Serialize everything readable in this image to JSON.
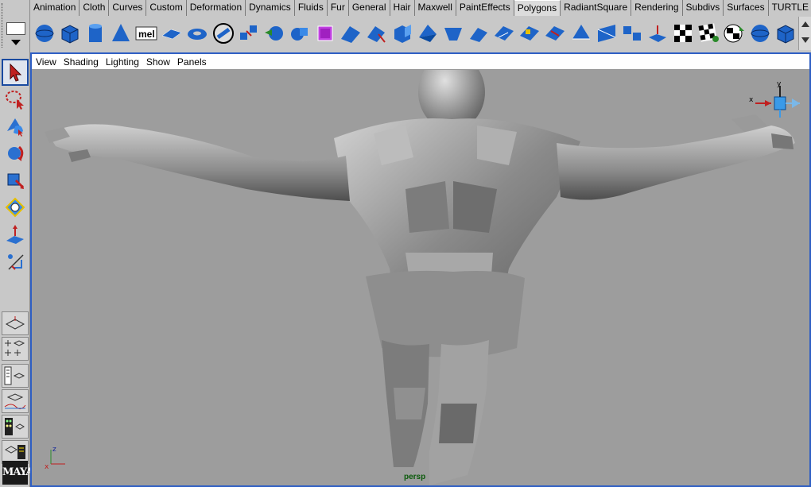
{
  "shelf": {
    "tabs": [
      "Animation",
      "Cloth",
      "Curves",
      "Custom",
      "Deformation",
      "Dynamics",
      "Fluids",
      "Fur",
      "General",
      "Hair",
      "Maxwell",
      "PaintEffects",
      "Polygons",
      "RadiantSquare",
      "Rendering",
      "Subdivs",
      "Surfaces",
      "TURTLE"
    ],
    "active_tab": "Polygons",
    "mel_label": "mel",
    "icons": [
      "poly-sphere-icon",
      "poly-cube-icon",
      "poly-cylinder-icon",
      "poly-cone-icon",
      "mel-script-icon",
      "poly-plane-icon",
      "poly-torus-icon",
      "poly-pipe-icon",
      "combine-icon",
      "boolean-icon",
      "separate-icon",
      "smooth-proxy-icon",
      "append-polygon-icon",
      "split-polygon-icon",
      "extrude-face-icon",
      "bevel-icon",
      "wedge-face-icon",
      "poke-face-icon",
      "duplicate-face-icon",
      "extract-icon",
      "merge-vertices-icon",
      "fill-hole-icon",
      "triangulate-icon",
      "quadrangulate-icon",
      "reduce-icon",
      "cleanup-icon",
      "uv-planar-icon",
      "uv-texture-editor-icon",
      "checker-map-icon",
      "uv-auto-icon"
    ]
  },
  "toolbox": {
    "tools": [
      "select-arrow-icon",
      "lasso-select-icon",
      "paint-select-icon",
      "move-tool-icon",
      "rotate-tool-icon",
      "scale-tool-icon",
      "universal-manipulator-icon",
      "soft-mod-icon"
    ],
    "layouts": [
      "single-pane-layout-icon",
      "four-pane-layout-icon",
      "outliner-layout-icon",
      "graph-editor-layout-icon",
      "hypershade-layout-icon",
      "script-editor-layout-icon"
    ],
    "logo_text": "MAYA"
  },
  "panel": {
    "menu": [
      "View",
      "Shading",
      "Lighting",
      "Show",
      "Panels"
    ],
    "camera_label": "persp",
    "axis": {
      "x": "x",
      "z": "z"
    },
    "view_cube": {
      "x_label": "x",
      "y_label": "y"
    }
  },
  "colors": {
    "panel_border": "#2f5fc4",
    "viewport_bg": "#9d9d9d",
    "icon_blue": "#1e64c8",
    "ui_gray": "#c8c8c8"
  }
}
